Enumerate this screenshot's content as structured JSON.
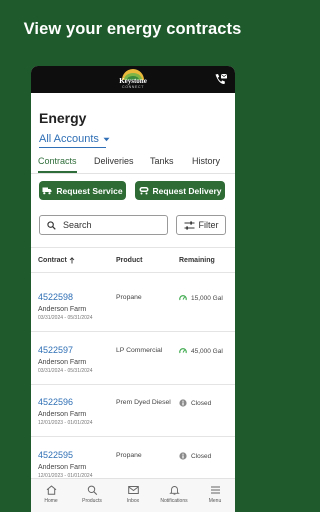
{
  "promo": {
    "headline": "View your energy contracts"
  },
  "header": {
    "logo_name": "Keystone",
    "logo_sub": "CONNECT"
  },
  "page": {
    "title": "Energy",
    "account_selector": "All Accounts"
  },
  "tabs": [
    {
      "label": "Contracts",
      "active": true
    },
    {
      "label": "Deliveries",
      "active": false
    },
    {
      "label": "Tanks",
      "active": false
    },
    {
      "label": "History",
      "active": false
    }
  ],
  "actions": {
    "request_service": "Request Service",
    "request_delivery": "Request Delivery"
  },
  "search": {
    "placeholder": "Search"
  },
  "filter": {
    "label": "Filter"
  },
  "table": {
    "columns": {
      "contract": "Contract",
      "product": "Product",
      "remaining": "Remaining"
    },
    "rows": [
      {
        "id": "4522598",
        "farm": "Anderson Farm",
        "dates": "03/31/2024 - 05/31/2024",
        "product": "Propane",
        "remaining": "15,000 Gal",
        "status": "gauge"
      },
      {
        "id": "4522597",
        "farm": "Anderson Farm",
        "dates": "03/31/2024 - 05/31/2024",
        "product": "LP Commercial",
        "remaining": "45,000 Gal",
        "status": "gauge"
      },
      {
        "id": "4522596",
        "farm": "Anderson Farm",
        "dates": "12/01/2023 - 01/01/2024",
        "product": "Prem Dyed Diesel",
        "remaining": "Closed",
        "status": "closed"
      },
      {
        "id": "4522595",
        "farm": "Anderson Farm",
        "dates": "12/01/2023 - 01/01/2024",
        "product": "Propane",
        "remaining": "Closed",
        "status": "closed"
      }
    ]
  },
  "nav": [
    {
      "label": "Home",
      "icon": "home-icon"
    },
    {
      "label": "Products",
      "icon": "search-icon"
    },
    {
      "label": "Inbox",
      "icon": "mail-icon"
    },
    {
      "label": "Notifications",
      "icon": "bell-icon"
    },
    {
      "label": "Menu",
      "icon": "menu-icon"
    }
  ],
  "colors": {
    "brand_green": "#2e6b35",
    "background": "#1e5a2b",
    "link_blue": "#2f6fb5",
    "gauge_green": "#3aa84a"
  }
}
